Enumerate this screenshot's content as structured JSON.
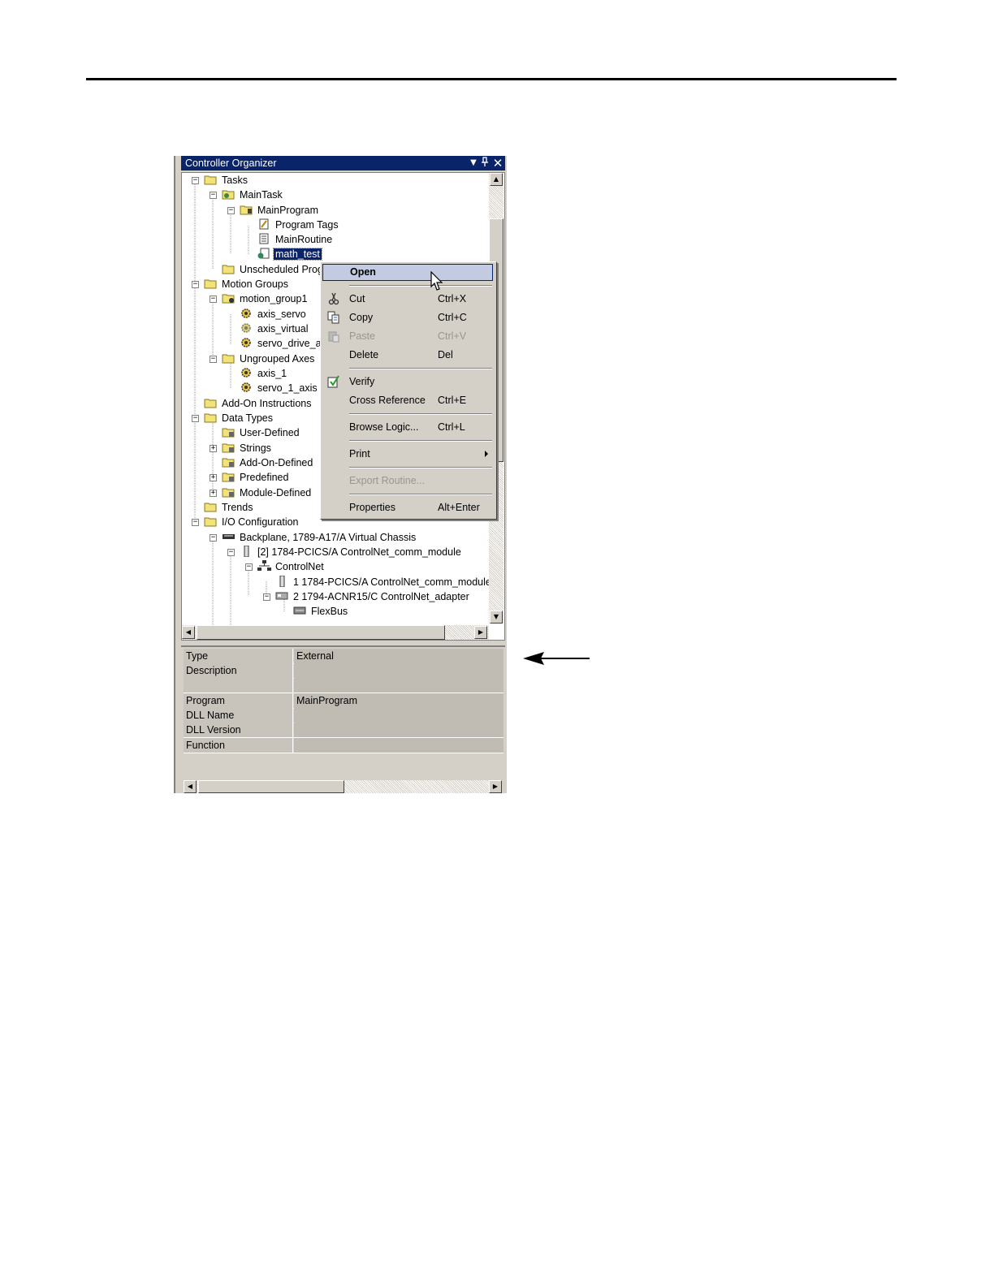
{
  "window": {
    "title": "Controller Organizer",
    "pin_down_icon": "dropdown-arrow-icon",
    "pin_icon": "pin-icon",
    "close_icon": "close-icon"
  },
  "tree": {
    "items": [
      {
        "label": "Tasks",
        "icon": "folder-open-icon"
      },
      {
        "label": "MainTask",
        "icon": "task-icon"
      },
      {
        "label": "MainProgram",
        "icon": "program-icon"
      },
      {
        "label": "Program Tags",
        "icon": "program-tags-icon"
      },
      {
        "label": "MainRoutine",
        "icon": "routine-icon"
      },
      {
        "label": "math_test",
        "icon": "external-routine-icon"
      },
      {
        "label": "Unscheduled Progr",
        "icon": "folder-icon"
      },
      {
        "label": "Motion Groups",
        "icon": "folder-open-icon"
      },
      {
        "label": "motion_group1",
        "icon": "motion-group-icon"
      },
      {
        "label": "axis_servo",
        "icon": "axis-icon"
      },
      {
        "label": "axis_virtual",
        "icon": "axis-icon"
      },
      {
        "label": "servo_drive_a",
        "icon": "axis-icon"
      },
      {
        "label": "Ungrouped Axes",
        "icon": "folder-open-icon"
      },
      {
        "label": "axis_1",
        "icon": "axis-icon"
      },
      {
        "label": "servo_1_axis",
        "icon": "axis-icon"
      },
      {
        "label": "Add-On Instructions",
        "icon": "folder-icon"
      },
      {
        "label": "Data Types",
        "icon": "folder-open-icon"
      },
      {
        "label": "User-Defined",
        "icon": "datatype-folder-icon"
      },
      {
        "label": "Strings",
        "icon": "datatype-folder-icon"
      },
      {
        "label": "Add-On-Defined",
        "icon": "datatype-folder-icon"
      },
      {
        "label": "Predefined",
        "icon": "datatype-folder-icon"
      },
      {
        "label": "Module-Defined",
        "icon": "datatype-folder-icon"
      },
      {
        "label": "Trends",
        "icon": "folder-icon"
      },
      {
        "label": "I/O Configuration",
        "icon": "folder-open-icon"
      },
      {
        "label": "Backplane, 1789-A17/A Virtual Chassis",
        "icon": "backplane-icon"
      },
      {
        "label": "[2] 1784-PCICS/A ControlNet_comm_module",
        "icon": "module-icon"
      },
      {
        "label": "ControlNet",
        "icon": "network-icon"
      },
      {
        "label": "1 1784-PCICS/A ControlNet_comm_module",
        "icon": "module-icon"
      },
      {
        "label": "2 1794-ACNR15/C ControlNet_adapter",
        "icon": "adapter-icon"
      },
      {
        "label": "FlexBus",
        "icon": "bus-icon"
      }
    ]
  },
  "context_menu": {
    "items": [
      {
        "label": "Open",
        "shortcut": ""
      },
      {
        "label": "Cut",
        "shortcut": "Ctrl+X",
        "icon": "scissors-icon"
      },
      {
        "label": "Copy",
        "shortcut": "Ctrl+C",
        "icon": "copy-icon"
      },
      {
        "label": "Paste",
        "shortcut": "Ctrl+V",
        "icon": "paste-icon"
      },
      {
        "label": "Delete",
        "shortcut": "Del"
      },
      {
        "label": "Verify",
        "shortcut": "",
        "icon": "verify-icon"
      },
      {
        "label": "Cross Reference",
        "shortcut": "Ctrl+E"
      },
      {
        "label": "Browse Logic...",
        "shortcut": "Ctrl+L"
      },
      {
        "label": "Print",
        "shortcut": ""
      },
      {
        "label": "Export Routine...",
        "shortcut": ""
      },
      {
        "label": "Properties",
        "shortcut": "Alt+Enter"
      }
    ]
  },
  "properties": {
    "rows": [
      {
        "key": "Type",
        "value": "External"
      },
      {
        "key": "Description",
        "value": ""
      },
      {
        "key": "",
        "value": ""
      },
      {
        "key": "Program",
        "value": "MainProgram"
      },
      {
        "key": "DLL Name",
        "value": ""
      },
      {
        "key": "DLL Version",
        "value": ""
      },
      {
        "key": "Function",
        "value": ""
      }
    ]
  },
  "colors": {
    "titlebar": "#0a246a",
    "selection": "#0a246a",
    "menu_highlight": "#c2cbe2",
    "folder": "#f2e27a"
  }
}
